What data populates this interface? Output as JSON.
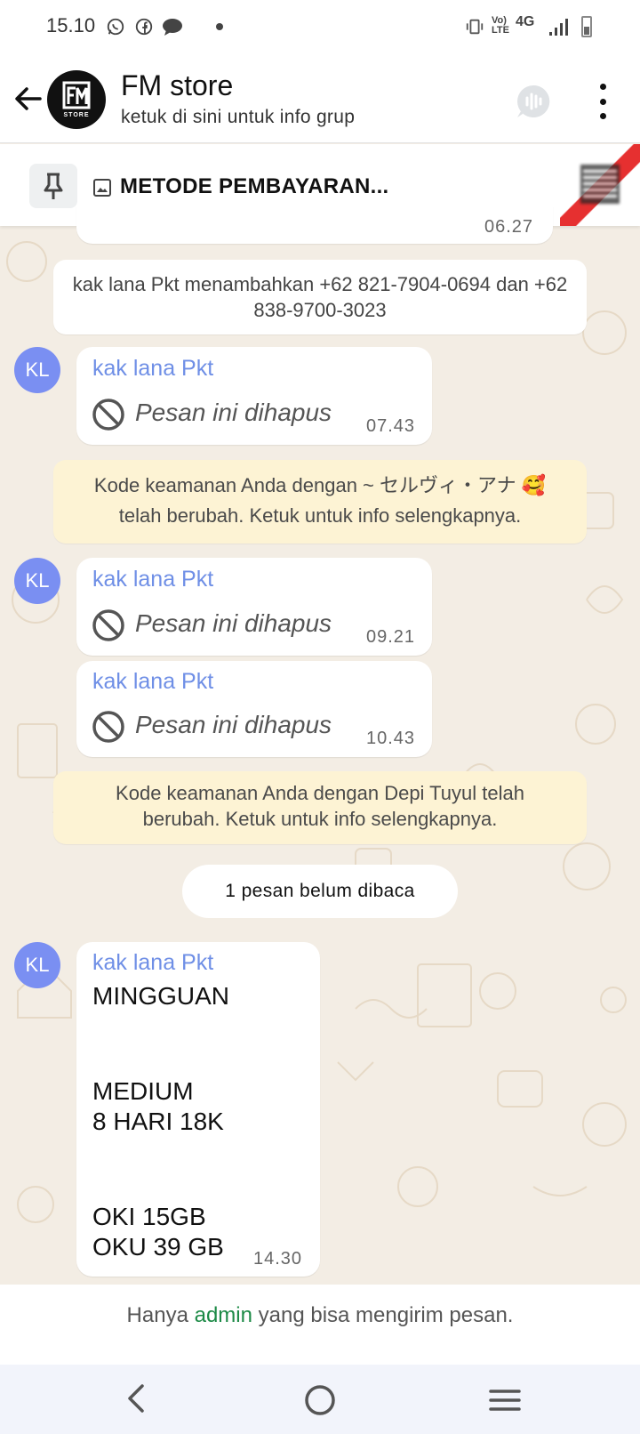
{
  "status_bar": {
    "time": "15.10",
    "network": "4G",
    "volte": "Vo) LTE"
  },
  "header": {
    "title": "FM store",
    "subtitle": "ketuk di sini untuk info grup",
    "avatar_text": "STORE"
  },
  "pinned": {
    "text": "METODE PEMBAYARAN..."
  },
  "messages": {
    "partial_time": "06.27",
    "system_added": "kak lana Pkt menambahkan +62 821-7904-0694 dan +62 838-9700-3023",
    "avatar_initials": "KL",
    "deleted_1": {
      "sender": "kak lana Pkt",
      "text": "Pesan ini dihapus",
      "time": "07.43"
    },
    "security_1": {
      "line1": "Kode keamanan Anda dengan ~ セルヴィ・アナ 🥰",
      "line2": "telah berubah. Ketuk untuk info selengkapnya."
    },
    "deleted_2": {
      "sender": "kak lana Pkt",
      "text": "Pesan ini dihapus",
      "time": "09.21"
    },
    "deleted_3": {
      "sender": "kak lana Pkt",
      "text": "Pesan ini dihapus",
      "time": "10.43"
    },
    "security_2": {
      "line1": "Kode keamanan Anda dengan Depi Tuyul telah",
      "line2": "berubah. Ketuk untuk info selengkapnya."
    },
    "unread_label": "1 pesan belum dibaca",
    "last": {
      "sender": "kak lana Pkt",
      "line1": "MINGGUAN",
      "line2": "MEDIUM",
      "line3": "8 HARI 18K",
      "line4": "OKI 15GB",
      "line5": "OKU 39 GB",
      "time": "14.30"
    }
  },
  "footer": {
    "prefix": "Hanya ",
    "admin": "admin",
    "suffix": " yang bisa mengirim pesan."
  },
  "colors": {
    "wallpaper": "#f3ede4",
    "avatar_bg": "#7a8ff2",
    "sender": "#6f8fe6",
    "system_yellow": "#fdf3d4",
    "admin_link": "#1c8a46"
  }
}
